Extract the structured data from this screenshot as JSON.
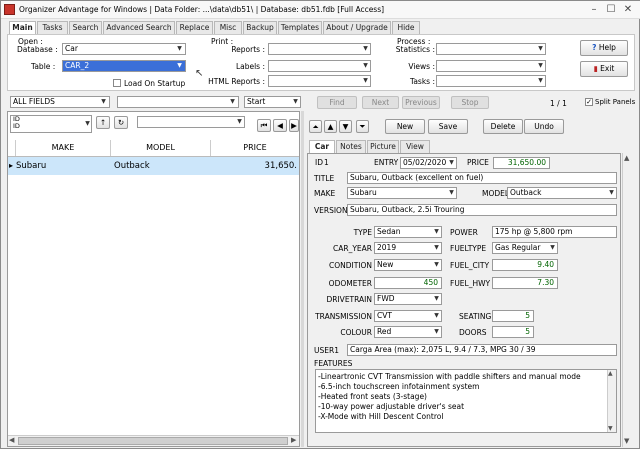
{
  "window": {
    "title": "Organizer Advantage for Windows | Data Folder: ...\\data\\db51\\ | Database: db51.fdb [Full Access]",
    "min": "–",
    "max": "☐",
    "close": "✕"
  },
  "menu_tabs": [
    "Main",
    "Tasks",
    "Search",
    "Advanced Search",
    "Replace",
    "Misc",
    "Backup",
    "Templates",
    "About / Upgrade",
    "Hide"
  ],
  "open": {
    "group_label": "Open :",
    "database_label": "Database :",
    "database_value": "Car",
    "table_label": "Table :",
    "table_value": "CAR_2",
    "load_on_startup": "Load On Startup"
  },
  "print": {
    "group_label": "Print :",
    "reports_label": "Reports :",
    "labels_label": "Labels :",
    "html_reports_label": "HTML Reports :"
  },
  "process": {
    "group_label": "Process :",
    "statistics_label": "Statistics :",
    "views_label": "Views :",
    "tasks_label": "Tasks :"
  },
  "side_buttons": {
    "help": "Help",
    "exit": "Exit"
  },
  "search_bar": {
    "field_value": "ALL FIELDS",
    "mode_value": "Start",
    "find": "Find",
    "next": "Next",
    "previous": "Previous",
    "stop": "Stop",
    "record_position": "1 / 1",
    "split_panels": "Split Panels"
  },
  "sort": {
    "field": "ID",
    "sub": "ID"
  },
  "grid": {
    "headers": [
      "MAKE",
      "MODEL",
      "PRICE"
    ],
    "rows": [
      {
        "make": "Subaru",
        "model": "Outback",
        "price": "31,650."
      }
    ]
  },
  "record_nav": {
    "new": "New",
    "save": "Save",
    "delete": "Delete",
    "undo": "Undo"
  },
  "detail_tabs": [
    "Car",
    "Notes",
    "Picture",
    "View"
  ],
  "record": {
    "id_label": "ID",
    "id_value": "1",
    "entry_label": "ENTRY",
    "entry_value": "05/02/2020",
    "price_label": "PRICE",
    "price_value": "31,650.00",
    "title_label": "TITLE",
    "title_value": "Subaru, Outback (excellent on fuel)",
    "make_label": "MAKE",
    "make_value": "Subaru",
    "model_label": "MODEL",
    "model_value": "Outback",
    "version_label": "VERSION",
    "version_value": "Subaru, Outback, 2.5i Trouring",
    "type_label": "TYPE",
    "type_value": "Sedan",
    "power_label": "POWER",
    "power_value": "175 hp @ 5,800 rpm",
    "car_year_label": "CAR_YEAR",
    "car_year_value": "2019",
    "fueltype_label": "FUELTYPE",
    "fueltype_value": "Gas Regular",
    "condition_label": "CONDITION",
    "condition_value": "New",
    "fuel_city_label": "FUEL_CITY",
    "fuel_city_value": "9.40",
    "odometer_label": "ODOMETER",
    "odometer_value": "450",
    "fuel_hwy_label": "FUEL_HWY",
    "fuel_hwy_value": "7.30",
    "drivetrain_label": "DRIVETRAIN",
    "drivetrain_value": "FWD",
    "transmission_label": "TRANSMISSION",
    "transmission_value": "CVT",
    "seating_label": "SEATING",
    "seating_value": "5",
    "colour_label": "COLOUR",
    "colour_value": "Red",
    "doors_label": "DOORS",
    "doors_value": "5",
    "user1_label": "USER1",
    "user1_value": "Carga Area (max): 2,075 L, 9.4 / 7.3,    MPG 30 / 39",
    "features_label": "FEATURES",
    "features": [
      "-Lineartronic CVT Transmission with paddle shifters and manual mode",
      "-6.5-inch touchscreen infotainment system",
      "-Heated front seats (3-stage)",
      "-10-way power adjustable driver's seat",
      "-X-Mode with Hill Descent Control"
    ]
  },
  "colors": {
    "selection": "#3b6fd8",
    "row_highlight": "#cce6fa",
    "numeric": "#006400",
    "app_icon": "#c8342b"
  }
}
